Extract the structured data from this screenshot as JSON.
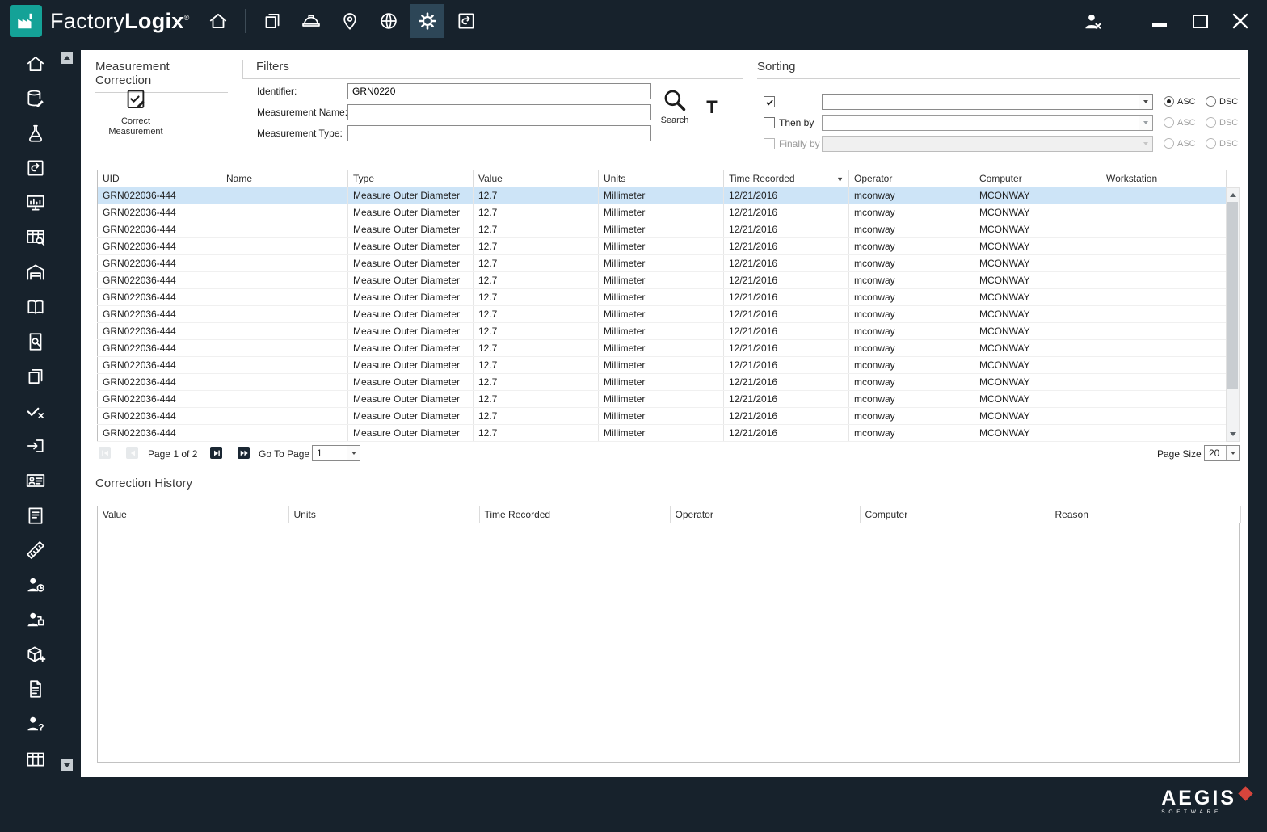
{
  "titlebar": {
    "brand_light": "Factory",
    "brand_bold": "Logix",
    "registered": "®",
    "nav_icons": [
      {
        "name": "documents-icon",
        "icon": "documents",
        "active": false
      },
      {
        "name": "hardhat-icon",
        "icon": "hardhat",
        "active": false
      },
      {
        "name": "location-pin-icon",
        "icon": "location-pin",
        "active": false
      },
      {
        "name": "globe-icon",
        "icon": "globe",
        "active": false
      },
      {
        "name": "gear-icon",
        "icon": "gear",
        "active": true
      },
      {
        "name": "revert-icon",
        "icon": "revert",
        "active": false
      }
    ]
  },
  "sidebar": {
    "items": [
      {
        "name": "sidebar-item-home",
        "icon": "home"
      },
      {
        "name": "sidebar-item-database-edit",
        "icon": "database-edit"
      },
      {
        "name": "sidebar-item-lab-flask",
        "icon": "lab-flask"
      },
      {
        "name": "sidebar-item-history",
        "icon": "history"
      },
      {
        "name": "sidebar-item-monitor-chart",
        "icon": "monitor-chart"
      },
      {
        "name": "sidebar-item-table-search",
        "icon": "table-search"
      },
      {
        "name": "sidebar-item-warehouse",
        "icon": "warehouse"
      },
      {
        "name": "sidebar-item-library",
        "icon": "library"
      },
      {
        "name": "sidebar-item-document-search",
        "icon": "document-search"
      },
      {
        "name": "sidebar-item-copy-pages",
        "icon": "copy-pages"
      },
      {
        "name": "sidebar-item-verify",
        "icon": "verify"
      },
      {
        "name": "sidebar-item-export",
        "icon": "export"
      },
      {
        "name": "sidebar-item-id-card",
        "icon": "id-card"
      },
      {
        "name": "sidebar-item-notes",
        "icon": "clipboard-notes"
      },
      {
        "name": "sidebar-item-measurement-remove",
        "icon": "ruler-remove"
      },
      {
        "name": "sidebar-item-operator-time",
        "icon": "operator-time"
      },
      {
        "name": "sidebar-item-operator-org",
        "icon": "operator-org"
      },
      {
        "name": "sidebar-item-package-add",
        "icon": "package-add"
      },
      {
        "name": "sidebar-item-document",
        "icon": "document"
      },
      {
        "name": "sidebar-item-operator-help",
        "icon": "operator-help"
      },
      {
        "name": "sidebar-item-table",
        "icon": "table"
      }
    ]
  },
  "measurement_correction": {
    "title": "Measurement Correction",
    "correct_button_label": "Correct Measurement"
  },
  "filters": {
    "title": "Filters",
    "fields": [
      {
        "label": "Identifier:",
        "value": "GRN0220"
      },
      {
        "label": "Measurement Name:",
        "value": ""
      },
      {
        "label": "Measurement Type:",
        "value": ""
      }
    ],
    "search_label": "Search",
    "text_filter_label": "T"
  },
  "sorting": {
    "title": "Sorting",
    "rows": [
      {
        "label": "",
        "checked": true,
        "selected_direction": "ASC"
      },
      {
        "label": "Then by",
        "checked": false,
        "selected_direction": null
      },
      {
        "label": "Finally by",
        "checked": false,
        "selected_direction": null
      }
    ],
    "asc_label": "ASC",
    "dsc_label": "DSC"
  },
  "grid": {
    "columns": [
      "UID",
      "Name",
      "Type",
      "Value",
      "Units",
      "Time Recorded",
      "Operator",
      "Computer",
      "Workstation"
    ],
    "sorted_column_index": 5,
    "sort_direction": "descending",
    "selected_row_index": 0,
    "rows": [
      {
        "uid": "GRN022036-444",
        "name": "",
        "type": "Measure Outer Diameter",
        "value": "12.7",
        "units": "Millimeter",
        "time_recorded": "12/21/2016",
        "operator": "mconway",
        "computer": "MCONWAY",
        "workstation": ""
      },
      {
        "uid": "GRN022036-444",
        "name": "",
        "type": "Measure Outer Diameter",
        "value": "12.7",
        "units": "Millimeter",
        "time_recorded": "12/21/2016",
        "operator": "mconway",
        "computer": "MCONWAY",
        "workstation": ""
      },
      {
        "uid": "GRN022036-444",
        "name": "",
        "type": "Measure Outer Diameter",
        "value": "12.7",
        "units": "Millimeter",
        "time_recorded": "12/21/2016",
        "operator": "mconway",
        "computer": "MCONWAY",
        "workstation": ""
      },
      {
        "uid": "GRN022036-444",
        "name": "",
        "type": "Measure Outer Diameter",
        "value": "12.7",
        "units": "Millimeter",
        "time_recorded": "12/21/2016",
        "operator": "mconway",
        "computer": "MCONWAY",
        "workstation": ""
      },
      {
        "uid": "GRN022036-444",
        "name": "",
        "type": "Measure Outer Diameter",
        "value": "12.7",
        "units": "Millimeter",
        "time_recorded": "12/21/2016",
        "operator": "mconway",
        "computer": "MCONWAY",
        "workstation": ""
      },
      {
        "uid": "GRN022036-444",
        "name": "",
        "type": "Measure Outer Diameter",
        "value": "12.7",
        "units": "Millimeter",
        "time_recorded": "12/21/2016",
        "operator": "mconway",
        "computer": "MCONWAY",
        "workstation": ""
      },
      {
        "uid": "GRN022036-444",
        "name": "",
        "type": "Measure Outer Diameter",
        "value": "12.7",
        "units": "Millimeter",
        "time_recorded": "12/21/2016",
        "operator": "mconway",
        "computer": "MCONWAY",
        "workstation": ""
      },
      {
        "uid": "GRN022036-444",
        "name": "",
        "type": "Measure Outer Diameter",
        "value": "12.7",
        "units": "Millimeter",
        "time_recorded": "12/21/2016",
        "operator": "mconway",
        "computer": "MCONWAY",
        "workstation": ""
      },
      {
        "uid": "GRN022036-444",
        "name": "",
        "type": "Measure Outer Diameter",
        "value": "12.7",
        "units": "Millimeter",
        "time_recorded": "12/21/2016",
        "operator": "mconway",
        "computer": "MCONWAY",
        "workstation": ""
      },
      {
        "uid": "GRN022036-444",
        "name": "",
        "type": "Measure Outer Diameter",
        "value": "12.7",
        "units": "Millimeter",
        "time_recorded": "12/21/2016",
        "operator": "mconway",
        "computer": "MCONWAY",
        "workstation": ""
      },
      {
        "uid": "GRN022036-444",
        "name": "",
        "type": "Measure Outer Diameter",
        "value": "12.7",
        "units": "Millimeter",
        "time_recorded": "12/21/2016",
        "operator": "mconway",
        "computer": "MCONWAY",
        "workstation": ""
      },
      {
        "uid": "GRN022036-444",
        "name": "",
        "type": "Measure Outer Diameter",
        "value": "12.7",
        "units": "Millimeter",
        "time_recorded": "12/21/2016",
        "operator": "mconway",
        "computer": "MCONWAY",
        "workstation": ""
      },
      {
        "uid": "GRN022036-444",
        "name": "",
        "type": "Measure Outer Diameter",
        "value": "12.7",
        "units": "Millimeter",
        "time_recorded": "12/21/2016",
        "operator": "mconway",
        "computer": "MCONWAY",
        "workstation": ""
      },
      {
        "uid": "GRN022036-444",
        "name": "",
        "type": "Measure Outer Diameter",
        "value": "12.7",
        "units": "Millimeter",
        "time_recorded": "12/21/2016",
        "operator": "mconway",
        "computer": "MCONWAY",
        "workstation": ""
      },
      {
        "uid": "GRN022036-444",
        "name": "",
        "type": "Measure Outer Diameter",
        "value": "12.7",
        "units": "Millimeter",
        "time_recorded": "12/21/2016",
        "operator": "mconway",
        "computer": "MCONWAY",
        "workstation": ""
      }
    ]
  },
  "pagination": {
    "page_label": "Page 1 of 2",
    "goto_label": "Go To Page",
    "goto_value": "1",
    "page_size_label": "Page Size",
    "page_size_value": "20"
  },
  "correction_history": {
    "title": "Correction History",
    "columns": [
      "Value",
      "Units",
      "Time Recorded",
      "Operator",
      "Computer",
      "Reason"
    ],
    "rows": []
  },
  "footer": {
    "brand": "AEGIS",
    "subtitle": "SOFTWARE"
  },
  "colors": {
    "titlebar_bg": "#17222c",
    "accent_teal": "#14a297",
    "active_tile": "#2d4657",
    "selected_row": "#cde4f7",
    "aegis_red": "#d6453c"
  }
}
